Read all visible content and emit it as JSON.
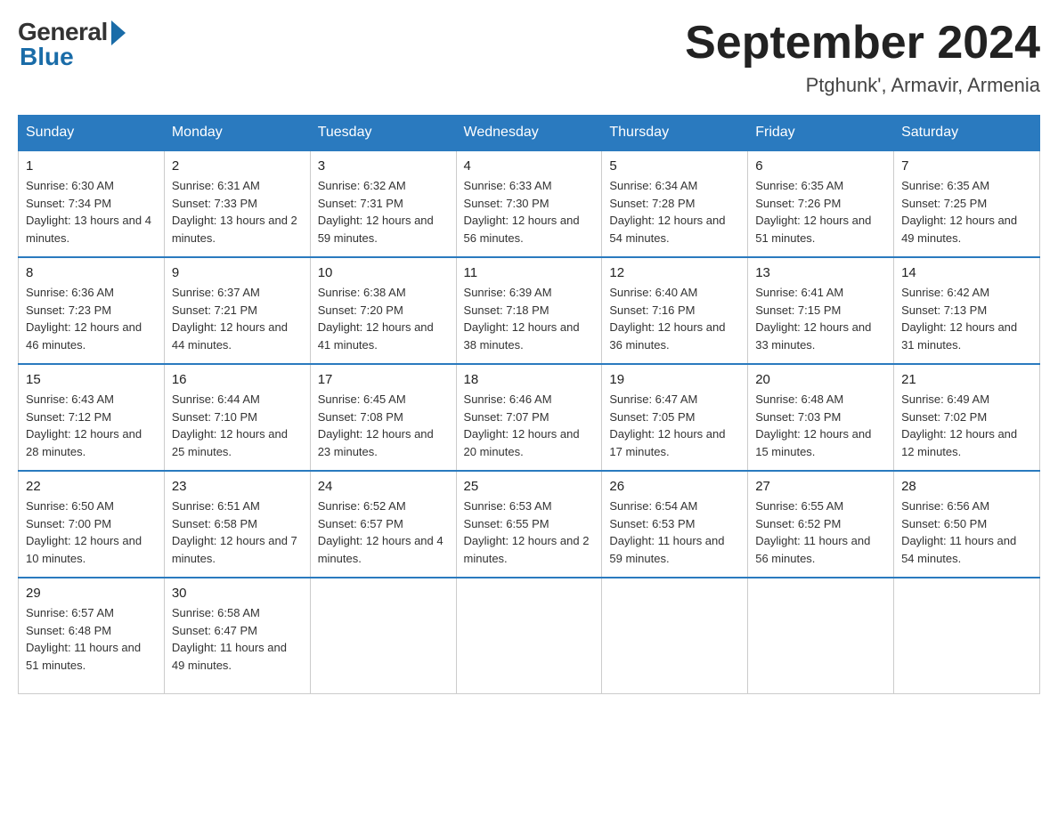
{
  "logo": {
    "general": "General",
    "blue": "Blue"
  },
  "title": "September 2024",
  "subtitle": "Ptghunk', Armavir, Armenia",
  "headers": [
    "Sunday",
    "Monday",
    "Tuesday",
    "Wednesday",
    "Thursday",
    "Friday",
    "Saturday"
  ],
  "weeks": [
    [
      {
        "day": "1",
        "sunrise": "Sunrise: 6:30 AM",
        "sunset": "Sunset: 7:34 PM",
        "daylight": "Daylight: 13 hours and 4 minutes."
      },
      {
        "day": "2",
        "sunrise": "Sunrise: 6:31 AM",
        "sunset": "Sunset: 7:33 PM",
        "daylight": "Daylight: 13 hours and 2 minutes."
      },
      {
        "day": "3",
        "sunrise": "Sunrise: 6:32 AM",
        "sunset": "Sunset: 7:31 PM",
        "daylight": "Daylight: 12 hours and 59 minutes."
      },
      {
        "day": "4",
        "sunrise": "Sunrise: 6:33 AM",
        "sunset": "Sunset: 7:30 PM",
        "daylight": "Daylight: 12 hours and 56 minutes."
      },
      {
        "day": "5",
        "sunrise": "Sunrise: 6:34 AM",
        "sunset": "Sunset: 7:28 PM",
        "daylight": "Daylight: 12 hours and 54 minutes."
      },
      {
        "day": "6",
        "sunrise": "Sunrise: 6:35 AM",
        "sunset": "Sunset: 7:26 PM",
        "daylight": "Daylight: 12 hours and 51 minutes."
      },
      {
        "day": "7",
        "sunrise": "Sunrise: 6:35 AM",
        "sunset": "Sunset: 7:25 PM",
        "daylight": "Daylight: 12 hours and 49 minutes."
      }
    ],
    [
      {
        "day": "8",
        "sunrise": "Sunrise: 6:36 AM",
        "sunset": "Sunset: 7:23 PM",
        "daylight": "Daylight: 12 hours and 46 minutes."
      },
      {
        "day": "9",
        "sunrise": "Sunrise: 6:37 AM",
        "sunset": "Sunset: 7:21 PM",
        "daylight": "Daylight: 12 hours and 44 minutes."
      },
      {
        "day": "10",
        "sunrise": "Sunrise: 6:38 AM",
        "sunset": "Sunset: 7:20 PM",
        "daylight": "Daylight: 12 hours and 41 minutes."
      },
      {
        "day": "11",
        "sunrise": "Sunrise: 6:39 AM",
        "sunset": "Sunset: 7:18 PM",
        "daylight": "Daylight: 12 hours and 38 minutes."
      },
      {
        "day": "12",
        "sunrise": "Sunrise: 6:40 AM",
        "sunset": "Sunset: 7:16 PM",
        "daylight": "Daylight: 12 hours and 36 minutes."
      },
      {
        "day": "13",
        "sunrise": "Sunrise: 6:41 AM",
        "sunset": "Sunset: 7:15 PM",
        "daylight": "Daylight: 12 hours and 33 minutes."
      },
      {
        "day": "14",
        "sunrise": "Sunrise: 6:42 AM",
        "sunset": "Sunset: 7:13 PM",
        "daylight": "Daylight: 12 hours and 31 minutes."
      }
    ],
    [
      {
        "day": "15",
        "sunrise": "Sunrise: 6:43 AM",
        "sunset": "Sunset: 7:12 PM",
        "daylight": "Daylight: 12 hours and 28 minutes."
      },
      {
        "day": "16",
        "sunrise": "Sunrise: 6:44 AM",
        "sunset": "Sunset: 7:10 PM",
        "daylight": "Daylight: 12 hours and 25 minutes."
      },
      {
        "day": "17",
        "sunrise": "Sunrise: 6:45 AM",
        "sunset": "Sunset: 7:08 PM",
        "daylight": "Daylight: 12 hours and 23 minutes."
      },
      {
        "day": "18",
        "sunrise": "Sunrise: 6:46 AM",
        "sunset": "Sunset: 7:07 PM",
        "daylight": "Daylight: 12 hours and 20 minutes."
      },
      {
        "day": "19",
        "sunrise": "Sunrise: 6:47 AM",
        "sunset": "Sunset: 7:05 PM",
        "daylight": "Daylight: 12 hours and 17 minutes."
      },
      {
        "day": "20",
        "sunrise": "Sunrise: 6:48 AM",
        "sunset": "Sunset: 7:03 PM",
        "daylight": "Daylight: 12 hours and 15 minutes."
      },
      {
        "day": "21",
        "sunrise": "Sunrise: 6:49 AM",
        "sunset": "Sunset: 7:02 PM",
        "daylight": "Daylight: 12 hours and 12 minutes."
      }
    ],
    [
      {
        "day": "22",
        "sunrise": "Sunrise: 6:50 AM",
        "sunset": "Sunset: 7:00 PM",
        "daylight": "Daylight: 12 hours and 10 minutes."
      },
      {
        "day": "23",
        "sunrise": "Sunrise: 6:51 AM",
        "sunset": "Sunset: 6:58 PM",
        "daylight": "Daylight: 12 hours and 7 minutes."
      },
      {
        "day": "24",
        "sunrise": "Sunrise: 6:52 AM",
        "sunset": "Sunset: 6:57 PM",
        "daylight": "Daylight: 12 hours and 4 minutes."
      },
      {
        "day": "25",
        "sunrise": "Sunrise: 6:53 AM",
        "sunset": "Sunset: 6:55 PM",
        "daylight": "Daylight: 12 hours and 2 minutes."
      },
      {
        "day": "26",
        "sunrise": "Sunrise: 6:54 AM",
        "sunset": "Sunset: 6:53 PM",
        "daylight": "Daylight: 11 hours and 59 minutes."
      },
      {
        "day": "27",
        "sunrise": "Sunrise: 6:55 AM",
        "sunset": "Sunset: 6:52 PM",
        "daylight": "Daylight: 11 hours and 56 minutes."
      },
      {
        "day": "28",
        "sunrise": "Sunrise: 6:56 AM",
        "sunset": "Sunset: 6:50 PM",
        "daylight": "Daylight: 11 hours and 54 minutes."
      }
    ],
    [
      {
        "day": "29",
        "sunrise": "Sunrise: 6:57 AM",
        "sunset": "Sunset: 6:48 PM",
        "daylight": "Daylight: 11 hours and 51 minutes."
      },
      {
        "day": "30",
        "sunrise": "Sunrise: 6:58 AM",
        "sunset": "Sunset: 6:47 PM",
        "daylight": "Daylight: 11 hours and 49 minutes."
      },
      null,
      null,
      null,
      null,
      null
    ]
  ]
}
